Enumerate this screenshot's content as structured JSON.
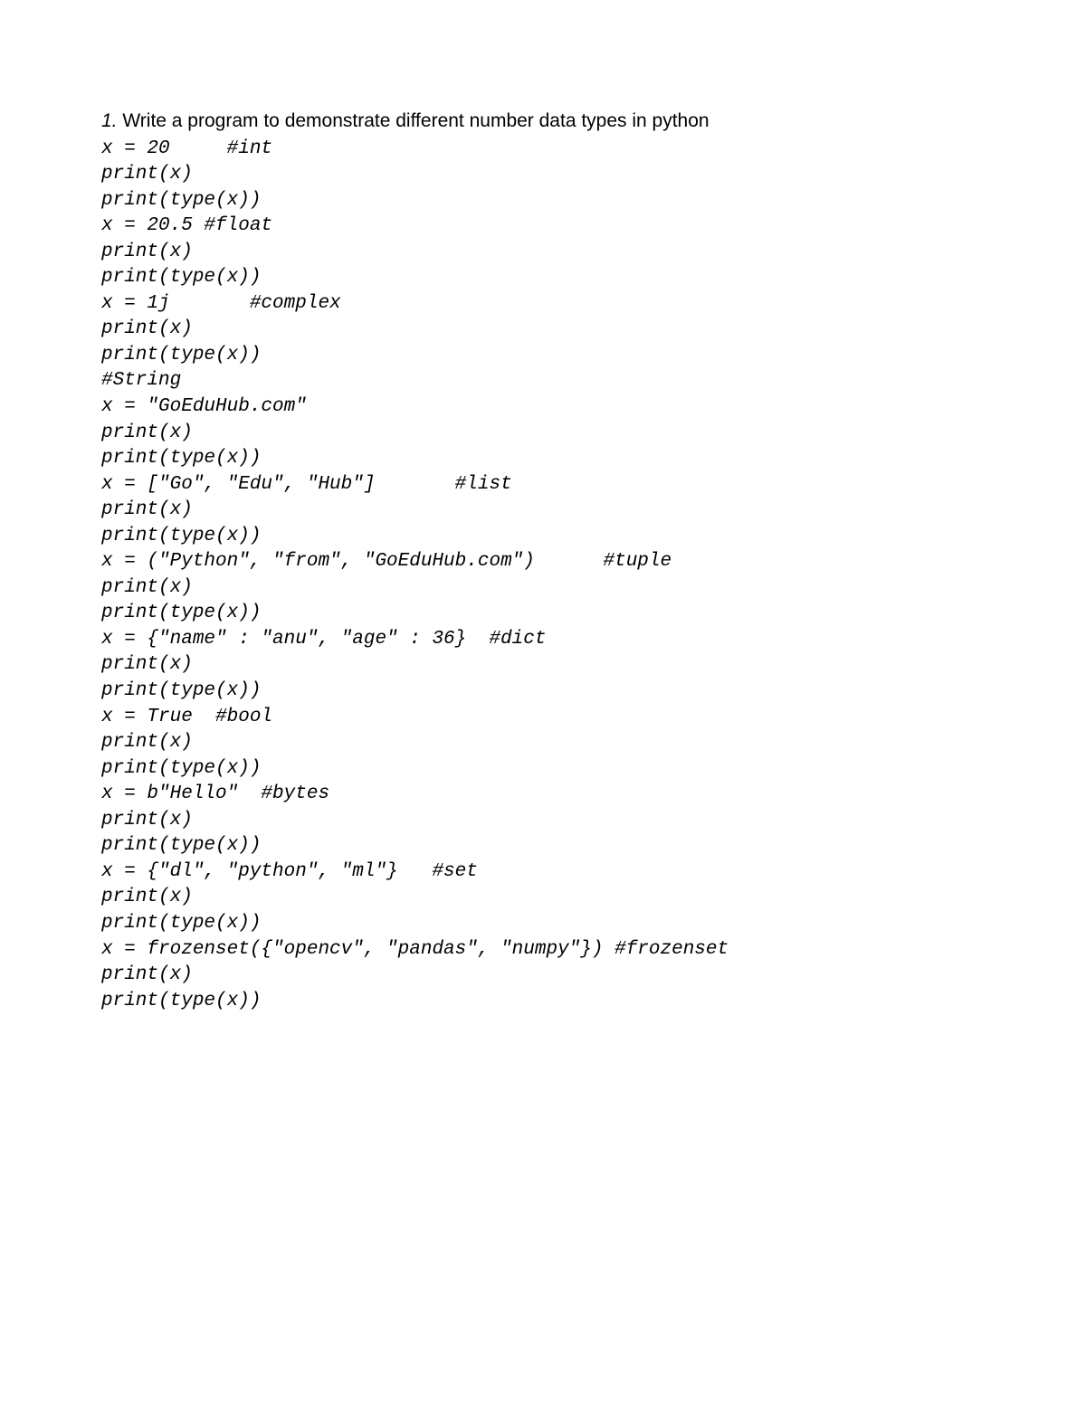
{
  "title": {
    "number": "1.",
    "text": " Write a program to demonstrate different number data types in python"
  },
  "code": {
    "lines": [
      "x = 20     #int",
      "print(x)",
      "print(type(x))",
      "x = 20.5 #float",
      "print(x)",
      "print(type(x))",
      "x = 1j       #complex",
      "print(x)",
      "print(type(x))",
      "#String",
      "x = \"GoEduHub.com\"",
      "print(x)",
      "print(type(x))",
      "x = [\"Go\", \"Edu\", \"Hub\"]       #list",
      "print(x)",
      "print(type(x))",
      "x = (\"Python\", \"from\", \"GoEduHub.com\")      #tuple",
      "print(x)",
      "print(type(x))",
      "x = {\"name\" : \"anu\", \"age\" : 36}  #dict",
      "print(x)",
      "print(type(x))",
      "x = True  #bool",
      "print(x)",
      "print(type(x))",
      "x = b\"Hello\"  #bytes",
      "print(x)",
      "print(type(x))",
      "x = {\"dl\", \"python\", \"ml\"}   #set",
      "print(x)",
      "print(type(x))",
      "x = frozenset({\"opencv\", \"pandas\", \"numpy\"}) #frozenset",
      "print(x)",
      "print(type(x))"
    ]
  }
}
